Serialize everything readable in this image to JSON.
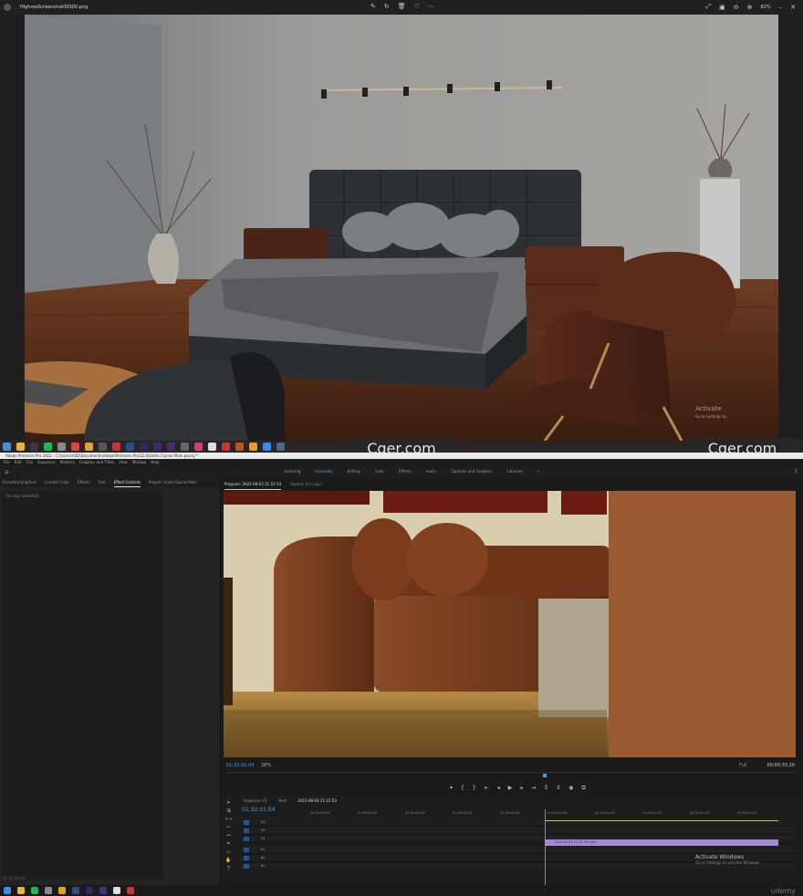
{
  "viewer": {
    "filename": "HighresScreenshot00000.png",
    "zoom": "82%",
    "activate_title": "Activate",
    "activate_sub": "Go to Settings to"
  },
  "watermark": {
    "left": "Cger.com",
    "right": "Cger.com"
  },
  "premiere": {
    "title": "Adobe Premiere Pro 2022 - C:\\Users\\A3D\\Documents\\Adobe\\Premiere Pro\\22.0\\Unite Course Main.prproj *",
    "menu": [
      "File",
      "Edit",
      "Clip",
      "Sequence",
      "Markers",
      "Graphics and Titles",
      "View",
      "Window",
      "Help"
    ],
    "workspaces": [
      "Learning",
      "Assembly",
      "Editing",
      "Color",
      "Effects",
      "Audio",
      "Captions and Graphics",
      "Libraries"
    ],
    "active_workspace": "Assembly",
    "left_tabs": [
      "Essential Graphics",
      "Lumetri Color",
      "Effects",
      "Text",
      "Effect Controls",
      "Project: Unite Course Main"
    ],
    "no_clip": "(no clips selected)",
    "left_footer": "01:32:01:04",
    "program_tabs": [
      "Program: 2022-08-03 21-22-53",
      "Source: (no clips)"
    ],
    "program_timecode": "01:32:01:04",
    "program_zoom": "28%",
    "program_fit": "Full",
    "program_duration": "00:00:33:20",
    "timeline_tabs": [
      "Sequence 01",
      "Nest",
      "2022-08-03 21-22-53"
    ],
    "timeline_timecode": "01:32:01:04",
    "ruler": [
      "01:32:00:00",
      "01:32:00:15",
      "01:32:00:20",
      "01:32:00:25",
      "01:32:01:00",
      "01:32:01:05",
      "01:32:01:10",
      "01:32:01:15",
      "01:32:01:20",
      "01:32:01:25"
    ],
    "tracks": [
      "V3",
      "V2",
      "V1",
      "A1",
      "A2",
      "A3"
    ],
    "clip_label": "2022-08-03 21-22-53.mp4",
    "activate_title": "Activate Windows",
    "activate_sub": "Go to Settings to activate Windows.",
    "udemy": "udemy"
  }
}
